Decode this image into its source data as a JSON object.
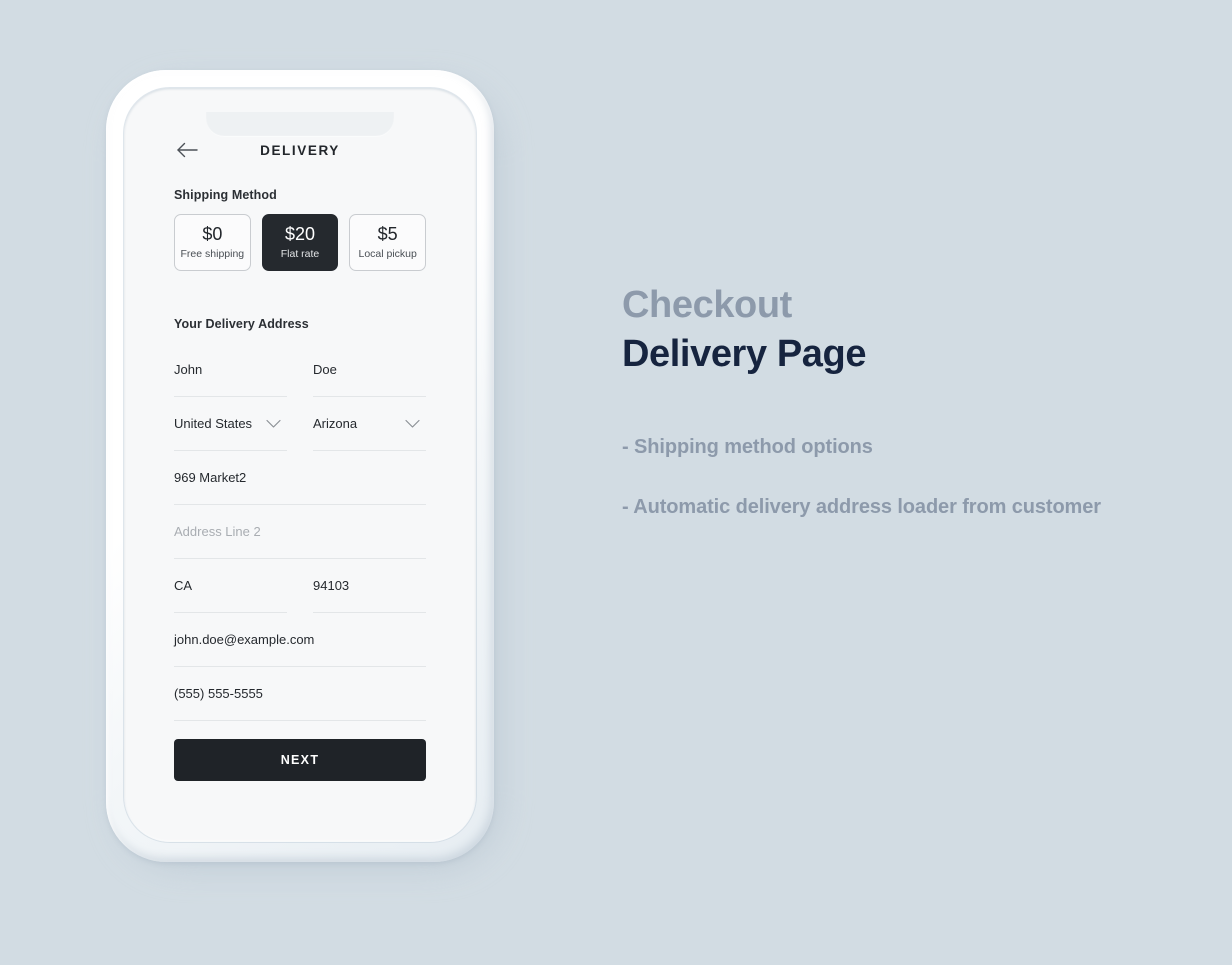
{
  "background_color": "#d2dce3",
  "phone": {
    "screen": {
      "header": {
        "back_icon": "arrow-left-icon",
        "title": "DELIVERY"
      },
      "shipping": {
        "label": "Shipping Method",
        "options": [
          {
            "price": "$0",
            "name": "Free shipping",
            "selected": false
          },
          {
            "price": "$20",
            "name": "Flat rate",
            "selected": true
          },
          {
            "price": "$5",
            "name": "Local pickup",
            "selected": false
          }
        ]
      },
      "address": {
        "label": "Your Delivery Address",
        "fields": [
          {
            "name": "first-name",
            "value": "John",
            "placeholder": "",
            "type": "text"
          },
          {
            "name": "last-name",
            "value": "Doe",
            "placeholder": "",
            "type": "text"
          },
          {
            "name": "country",
            "value": "United States",
            "placeholder": "",
            "type": "select"
          },
          {
            "name": "state",
            "value": "Arizona",
            "placeholder": "",
            "type": "select"
          },
          {
            "name": "address-line-1",
            "value": "969 Market2",
            "placeholder": "",
            "type": "text"
          },
          {
            "name": "address-line-2",
            "value": "",
            "placeholder": "Address Line 2",
            "type": "text"
          },
          {
            "name": "city",
            "value": "CA",
            "placeholder": "",
            "type": "text"
          },
          {
            "name": "postal-code",
            "value": "94103",
            "placeholder": "",
            "type": "text"
          },
          {
            "name": "email",
            "value": "john.doe@example.com",
            "placeholder": "",
            "type": "email"
          },
          {
            "name": "phone",
            "value": "(555) 555-5555",
            "placeholder": "",
            "type": "tel"
          }
        ]
      },
      "next_button": "NEXT"
    }
  },
  "info_panel": {
    "eyebrow": "Checkout",
    "heading": "Delivery Page",
    "eyebrow_color": "#8d9aab",
    "heading_color": "#16243f",
    "bullets": [
      "- Shipping method options",
      "- Automatic delivery address loader from customer"
    ]
  }
}
